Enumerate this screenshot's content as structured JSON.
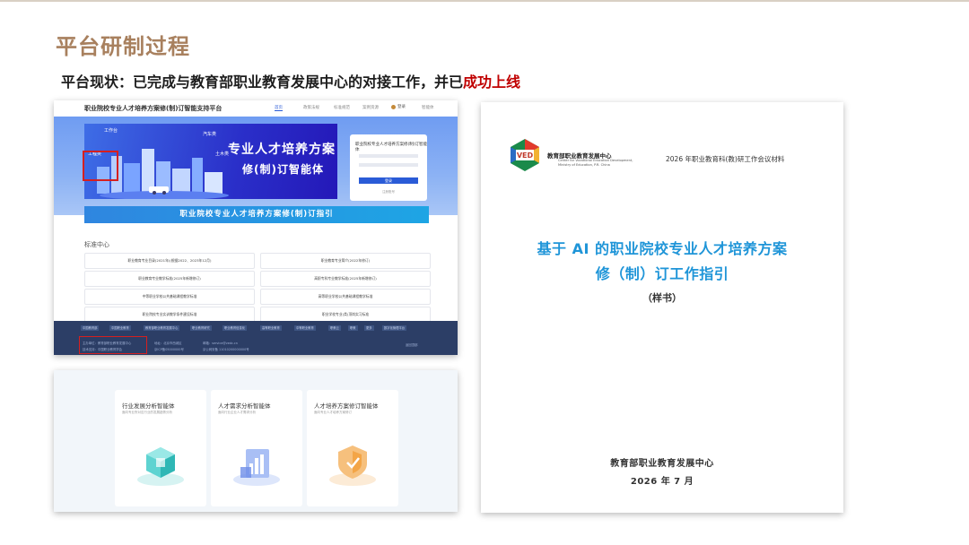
{
  "slide": {
    "title": "平台研制过程",
    "subtitle_prefix": "平台现状：已完成与教育部职业教育发展中心的对接工作，并已",
    "subtitle_highlight": "成功上线",
    "highlight_color": "#c00000",
    "title_color": "#a8805e"
  },
  "platform": {
    "name": "职业院校专业人才培养方案修(制)订智能支持平台",
    "nav": [
      "首页",
      "政策法规",
      "标准规范",
      "案例资源",
      "智能体"
    ],
    "login_label": "登录",
    "banner_line1": "专业人才培养方案",
    "banner_line2": "修(制)订智能体",
    "banner_tags": [
      "工作台",
      "汽车类",
      "工程类",
      "土木类"
    ],
    "login_title": "职业院校专业人才培养方案修(制)订智能体",
    "login_button": "登录",
    "login_link": "注册账号",
    "guide_banner": "职业院校专业人才培养方案修(制)订指引",
    "section_title": "标准中心",
    "cards": [
      "职业教育专业目录(2021年)(根据2022、2023年12月)",
      "职业教育专业简介(2022年修订)",
      "职业教育专业教学标准(2025年新增修订)",
      "高职专科专业教学标准(2025年新增修订)",
      "中等职业学校公共基础课程教学标准",
      "高等职业学校公共基础课程教学标准",
      "职业院校专业实训教学条件建设标准",
      "职业学校专业(类)顶岗实习标准"
    ],
    "footer_links": [
      "中国教育部",
      "中国职业教育",
      "教育部职业教育发展中心",
      "职业教育研究",
      "职业教育信息化",
      "高等职业教育",
      "中等职业教育",
      "职教云",
      "职教",
      "更多",
      "数字化管理平台"
    ],
    "footer_info": [
      "主办单位：教育部职业教育发展中心",
      "技术支持：中国职业教育学会",
      "地址：北京市西城区",
      "邮箱：service@vedc.cn",
      "京ICP备05000000号",
      "京公网安备 11010200000000号"
    ],
    "footer_right": "返回顶部"
  },
  "agents": [
    {
      "title": "行业发展分析智能体",
      "desc": "面向专业所对应行业的发展趋势分析"
    },
    {
      "title": "人才需求分析智能体",
      "desc": "面向行业企业人才需求分析"
    },
    {
      "title": "人才培养方案修订智能体",
      "desc": "面向专业人才培养方案修订"
    }
  ],
  "document": {
    "org_cn": "教育部职业教育发展中心",
    "org_en": [
      "Center for Vocational Education Development,",
      "Ministry of Education, P.R. China"
    ],
    "logo_text": "VED",
    "meeting": "2026 年职业教育科(教)研工作会议材料",
    "title_line1": "基于 AI 的职业院校专业人才培养方案",
    "title_line2": "修（制）订工作指引",
    "sample": "（样书）",
    "footer_org": "教育部职业教育发展中心",
    "footer_date": "2026 年 7 月",
    "title_color": "#1f95d8"
  }
}
